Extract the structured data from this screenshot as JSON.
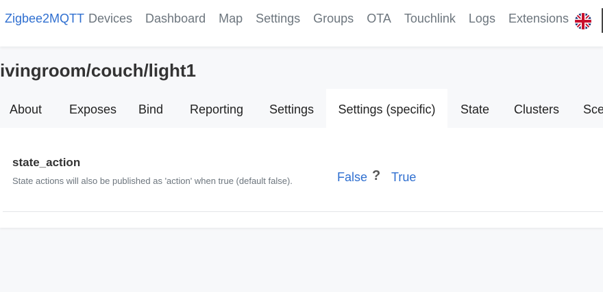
{
  "navbar": {
    "brand": "Zigbee2MQTT",
    "links": [
      "Devices",
      "Dashboard",
      "Map",
      "Settings",
      "Groups",
      "OTA",
      "Touchlink",
      "Logs",
      "Extensions"
    ],
    "language_icon": "uk-flag-icon"
  },
  "page": {
    "title": "ivingroom/couch/light1"
  },
  "tabs": {
    "items": [
      "About",
      "Exposes",
      "Bind",
      "Reporting",
      "Settings",
      "Settings (specific)",
      "State",
      "Clusters",
      "Sce"
    ],
    "active": "Settings (specific)"
  },
  "setting": {
    "name": "state_action",
    "description": "State actions will also be published as 'action' when true (default false).",
    "options": [
      "False",
      "?",
      "True"
    ]
  },
  "colors": {
    "accent": "#2f6fd0",
    "muted": "#6c757d",
    "background": "#f7f8fa"
  }
}
